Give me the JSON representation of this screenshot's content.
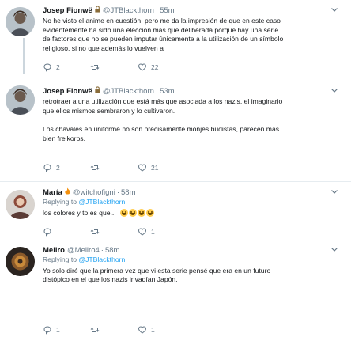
{
  "tweets": [
    {
      "name": "Josep Fionwë",
      "handle": "@JTBlackthorn",
      "time": "55m",
      "lines": [
        "No he visto el anime en cuestión, pero me da la impresión de que en este caso",
        "evidentemente ha sido una elección más que deliberada porque hay una serie",
        "de factores que no se pueden imputar únicamente a la utilización de un símbolo",
        "religioso, si no que además lo vuelven a"
      ],
      "replies": "2",
      "retweets": "",
      "likes": "22"
    },
    {
      "name": "Josep Fionwë",
      "handle": "@JTBlackthorn",
      "time": "53m",
      "lines": [
        "retrotraer a una utilización que está más que asociada a los nazis, el imaginario",
        "que ellos mismos sembraron y lo cultivaron."
      ],
      "lines2": [
        "Los chavales en uniforme no son precisamente monjes budistas, parecen más",
        "bien freikorps."
      ],
      "replies": "2",
      "retweets": "",
      "likes": "21"
    },
    {
      "name": "María",
      "handle": "@witchofigni",
      "time": "58m",
      "reply_label": "Replying to",
      "reply_handle": "@JTBlackthorn",
      "text": "los colores y to es que...",
      "replies": "",
      "retweets": "",
      "likes": "1"
    },
    {
      "name": "Mellro",
      "handle": "@Mellro4",
      "time": "58m",
      "reply_label": "Replying to",
      "reply_handle": "@JTBlackthorn",
      "lines": [
        "Yo solo diré que la primera vez que vi esta serie pensé que era en un futuro",
        "distópico en el que los nazis invadían Japón."
      ],
      "replies": "1",
      "retweets": "",
      "likes": "1"
    }
  ],
  "colors": {
    "accent": "#1da1f2",
    "muted": "#657786",
    "text": "#14171a",
    "like": "#e0245e"
  },
  "icons": [
    "reply-icon",
    "retweet-icon",
    "like-icon",
    "caret-down-icon",
    "lock-icon",
    "fire-icon"
  ]
}
